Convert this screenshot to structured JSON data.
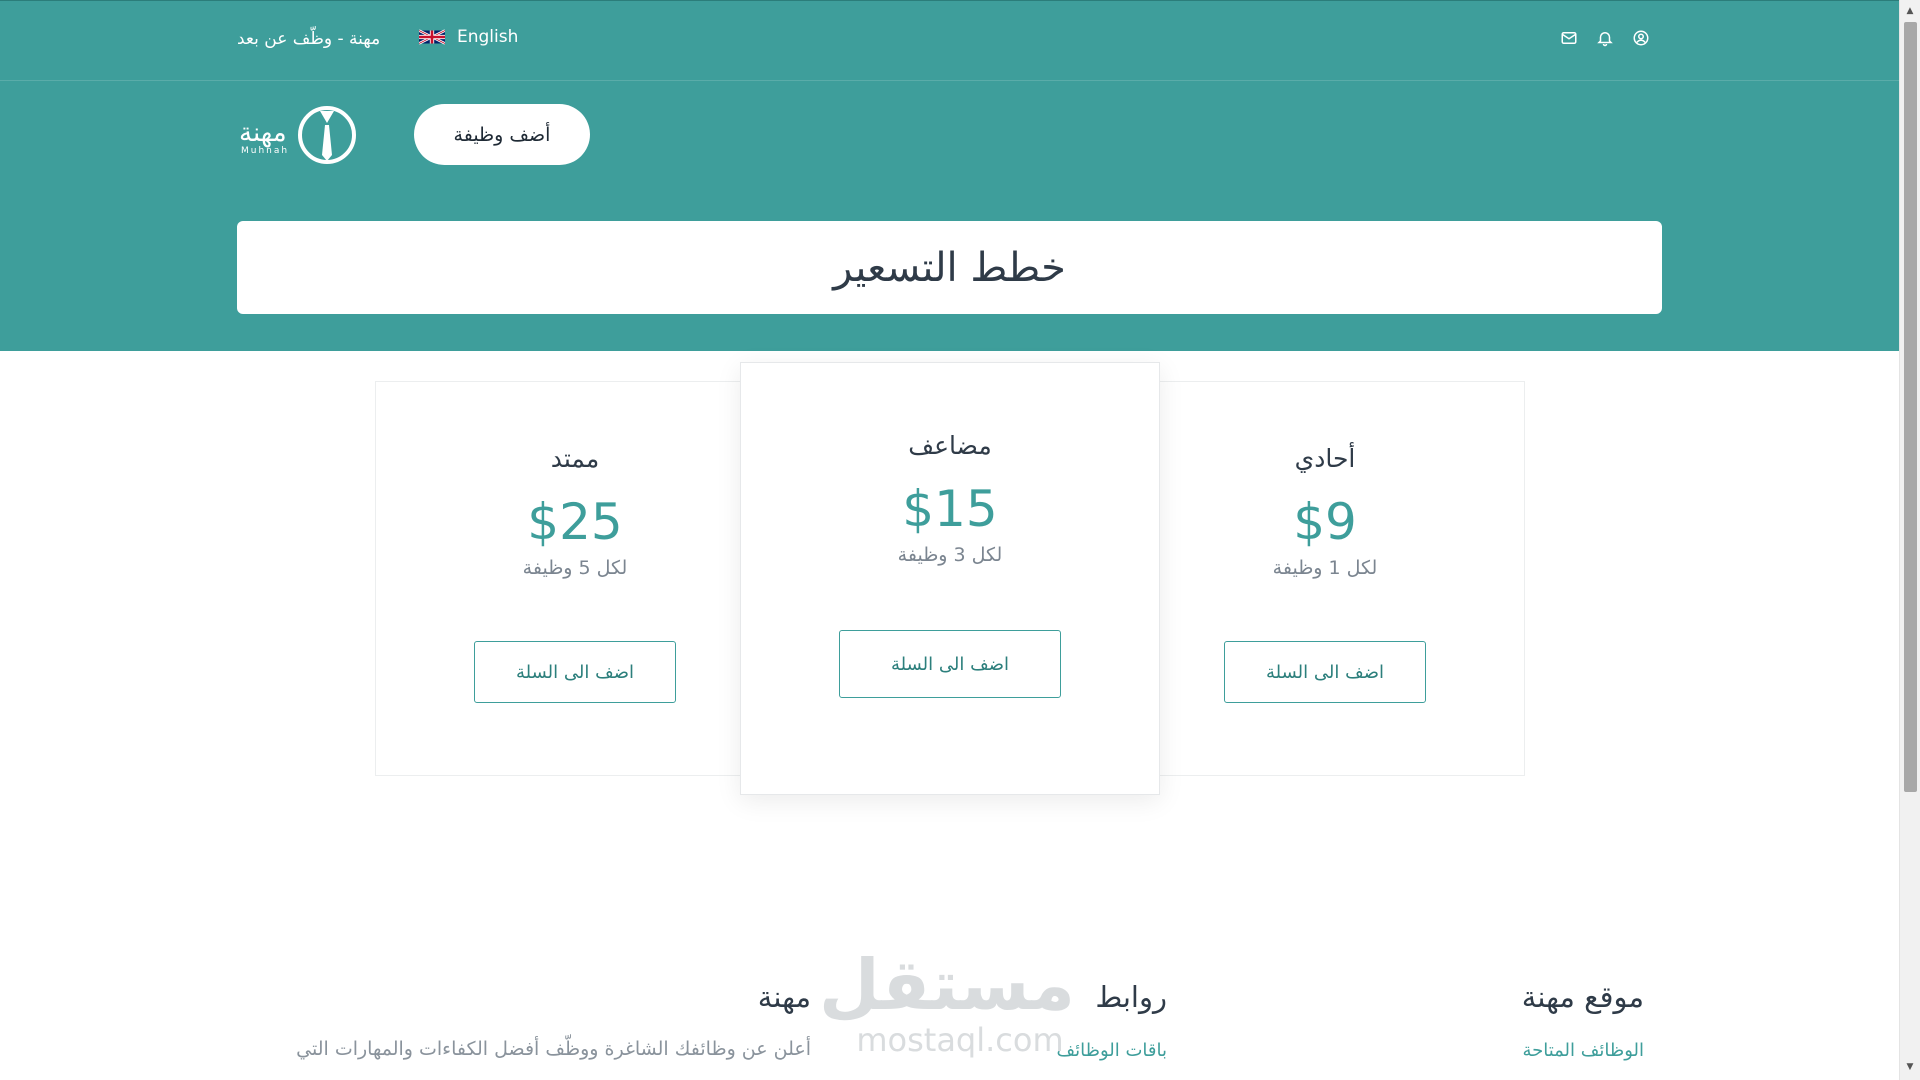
{
  "topbar": {
    "tagline": "مهنة - وظّف عن بعد",
    "language": "English",
    "icons": [
      "mail-icon",
      "bell-icon",
      "user-circle-icon"
    ]
  },
  "header": {
    "logo_ar": "مهنة",
    "logo_en": "Muhnah",
    "add_job_label": "أضف وظيفة",
    "page_title": "خطط التسعير"
  },
  "plans": [
    {
      "name": "ممتد",
      "price": "$25",
      "per": "لكل 5 وظيفة",
      "button": "اضف الى السلة"
    },
    {
      "name": "مضاعف",
      "price": "$15",
      "per": "لكل 3 وظيفة",
      "button": "اضف الى السلة"
    },
    {
      "name": "أحادي",
      "price": "$9",
      "per": "لكل 1 وظيفة",
      "button": "اضف الى السلة"
    }
  ],
  "footer": {
    "site_title": "موقع مهنة",
    "site_link": "الوظائف المتاحة",
    "links_title": "روابط",
    "links_item": "باقات الوظائف",
    "about_title": "مهنة",
    "about_text": "أعلن عن وظائفك الشاغرة ووظّف أفضل الكفاءات والمهارات التي"
  },
  "watermark": {
    "ar": "مستقل",
    "en": "mostaql.com"
  },
  "colors": {
    "primary": "#3e9e9b",
    "text": "#2f3b48",
    "muted": "#7b8590"
  }
}
